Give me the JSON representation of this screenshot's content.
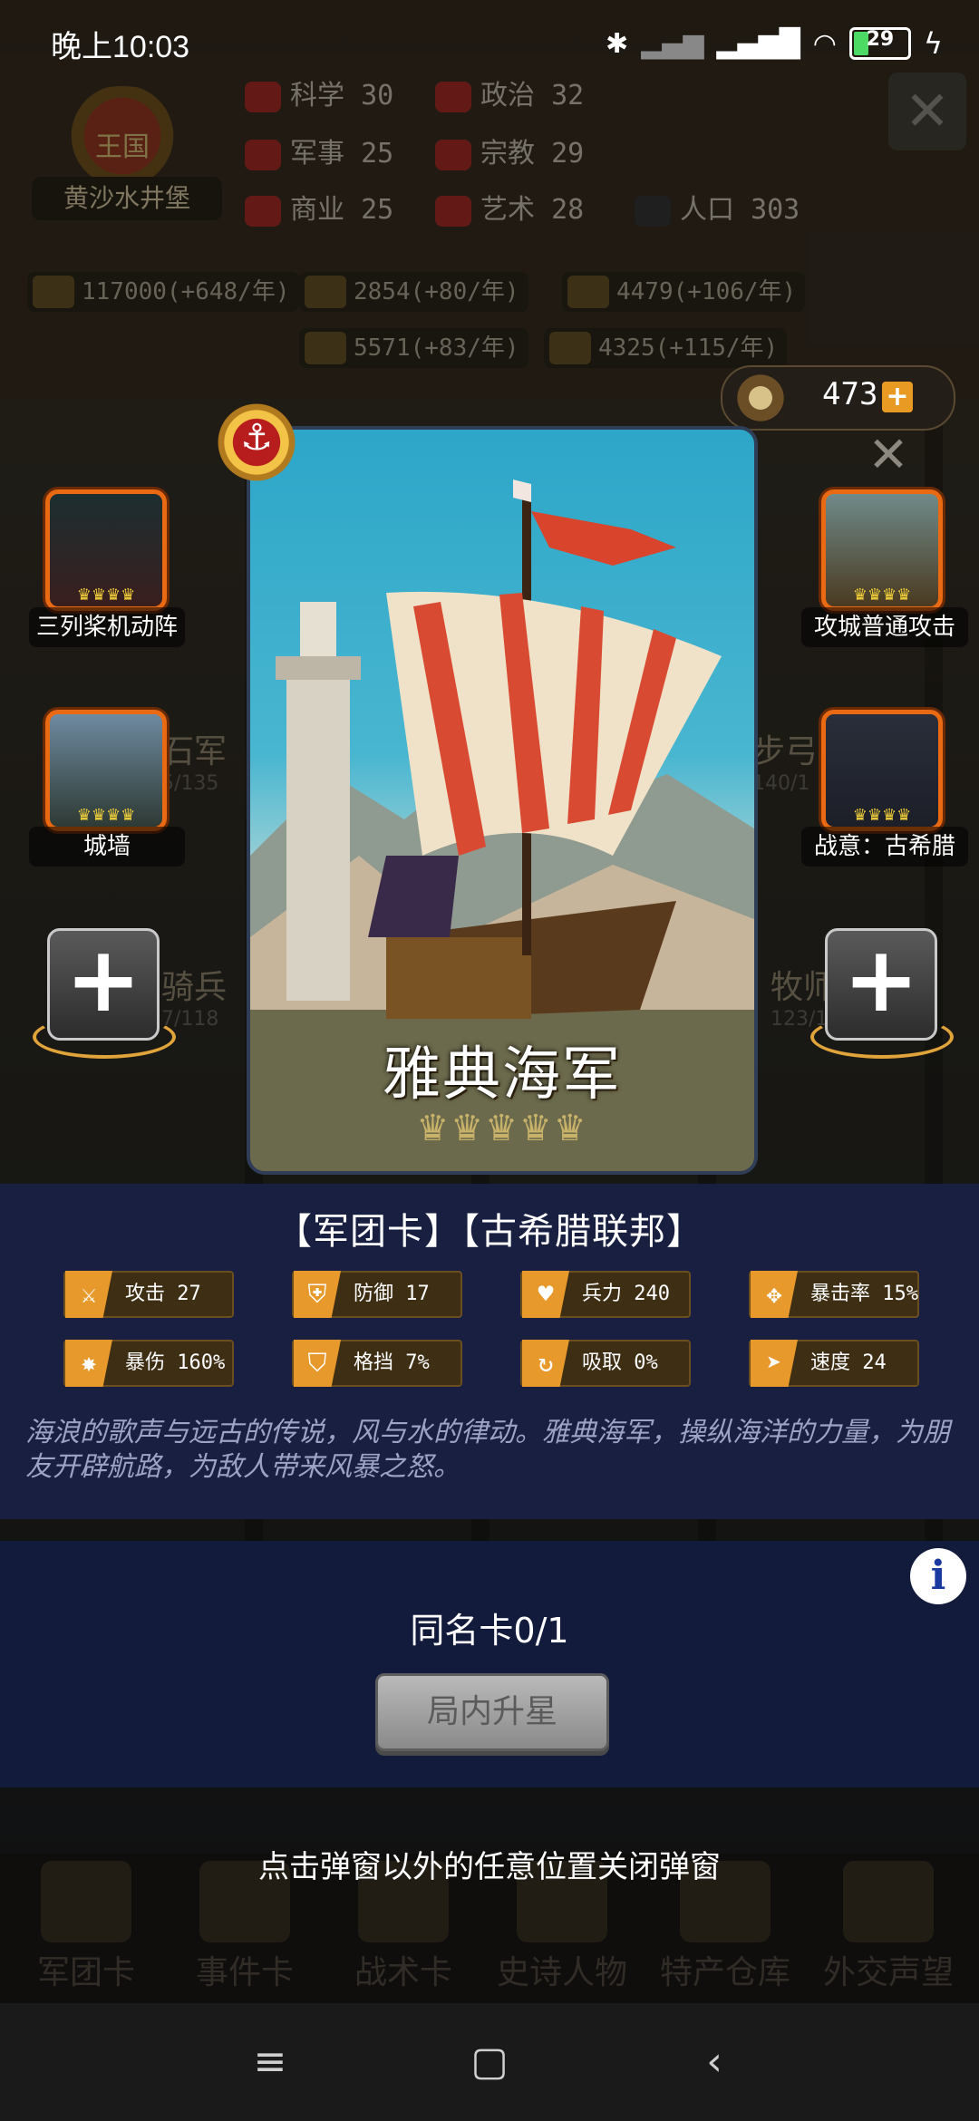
{
  "status_bar": {
    "time": "晚上10:03",
    "battery": "29"
  },
  "kingdom": {
    "badge": "王国",
    "name": "黄沙水井堡"
  },
  "stats": [
    {
      "label": "科学",
      "value": "30"
    },
    {
      "label": "政治",
      "value": "32"
    },
    {
      "label": "军事",
      "value": "25"
    },
    {
      "label": "宗教",
      "value": "29"
    },
    {
      "label": "商业",
      "value": "25"
    },
    {
      "label": "艺术",
      "value": "28"
    },
    {
      "label": "人口",
      "value": "303"
    }
  ],
  "resources": [
    "117000(+648/年)",
    "2854(+80/年)",
    "4479(+106/年)",
    "5571(+83/年)",
    "4325(+115/年)"
  ],
  "currency": {
    "amount": "473",
    "plus": "+"
  },
  "background_units": [
    {
      "name": "石军",
      "count": "5/135"
    },
    {
      "name": "步弓",
      "count": "140/1"
    },
    {
      "name": "骑兵",
      "count": "7/118"
    },
    {
      "name": "牧师",
      "count": "123/1"
    }
  ],
  "card": {
    "name": "雅典海军",
    "stars": "♛♛♛♛♛",
    "tags": "【军团卡】【古希腊联邦】",
    "stats": [
      {
        "icon": "sword-icon",
        "label": "攻击 27"
      },
      {
        "icon": "shield-icon",
        "label": "防御 17"
      },
      {
        "icon": "heart-icon",
        "label": "兵力 240"
      },
      {
        "icon": "crosshair-icon",
        "label": "暴击率 15%"
      },
      {
        "icon": "burst-icon",
        "label": "暴伤 160%"
      },
      {
        "icon": "parry-icon",
        "label": "格挡 7%"
      },
      {
        "icon": "drain-icon",
        "label": "吸取 0%"
      },
      {
        "icon": "boot-icon",
        "label": "速度 24"
      }
    ],
    "description": "海浪的歌声与远古的传说，风与水的律动。雅典海军，操纵海洋的力量，为朋友开辟航路，为敌人带来风暴之怒。",
    "skills_left": [
      {
        "label": "三列桨机动阵",
        "crowns": "♛♛♛♛"
      },
      {
        "label": "城墙",
        "crowns": "♛♛♛♛"
      }
    ],
    "skills_right": [
      {
        "label": "攻城普通攻击",
        "crowns": "♛♛♛♛"
      },
      {
        "label": "战意：古希腊",
        "crowns": "♛♛♛♛"
      }
    ]
  },
  "star_up": {
    "dup_count": "同名卡0/1",
    "button": "局内升星"
  },
  "close_hint": "点击弹窗以外的任意位置关闭弹窗",
  "bottom_nav": [
    "军团卡",
    "事件卡",
    "战术卡",
    "史诗人物",
    "特产仓库",
    "外交声望"
  ],
  "colors": {
    "accent": "#e96a12",
    "panel": "#1a2044",
    "gold": "#e79a2b"
  }
}
